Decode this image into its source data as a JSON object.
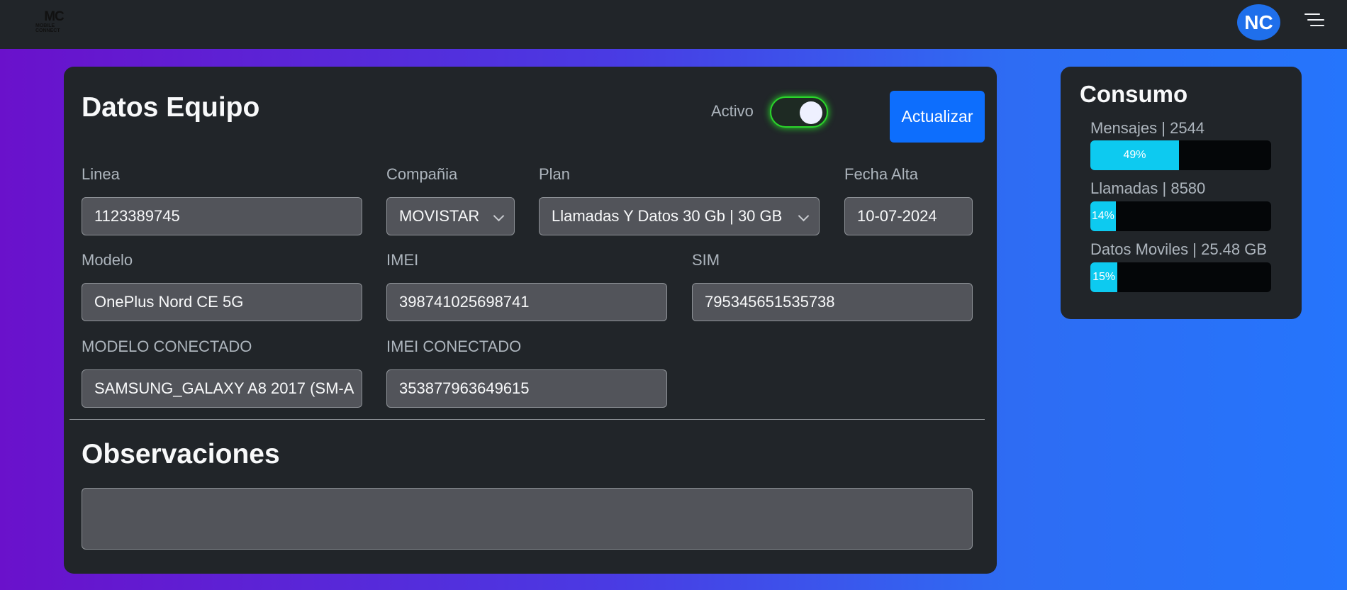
{
  "navbar": {
    "logo_text": "MC",
    "logo_subtext": "MOBILE CONNECT",
    "avatar_initials": "NC",
    "menu_icon": "hamburger-icon"
  },
  "equipo": {
    "title": "Datos Equipo",
    "activo_label": "Activo",
    "activo_state": true,
    "update_button": "Actualizar",
    "fields": {
      "linea": {
        "label": "Linea",
        "value": "1123389745"
      },
      "compania": {
        "label": "Compañia",
        "value": "MOVISTAR"
      },
      "plan": {
        "label": "Plan",
        "value": "Llamadas Y Datos 30 Gb | 30 GB"
      },
      "fecha_alta": {
        "label": "Fecha Alta",
        "value": "10-07-2024"
      },
      "modelo": {
        "label": "Modelo",
        "value": "OnePlus Nord CE 5G"
      },
      "imei": {
        "label": "IMEI",
        "value": "398741025698741"
      },
      "sim": {
        "label": "SIM",
        "value": "795345651535738"
      },
      "modelo_conectado": {
        "label": "MODELO CONECTADO",
        "value": "SAMSUNG_GALAXY A8 2017 (SM-A"
      },
      "imei_conectado": {
        "label": "IMEI CONECTADO",
        "value": "353877963649615"
      }
    },
    "observaciones_title": "Observaciones",
    "observaciones_value": ""
  },
  "consumo": {
    "title": "Consumo",
    "metrics": [
      {
        "label": "Mensajes | 2544",
        "percent_text": "49%",
        "percent": 49
      },
      {
        "label": "Llamadas | 8580",
        "percent_text": "14%",
        "percent": 14
      },
      {
        "label": "Datos Moviles | 25.48 GB",
        "percent_text": "15%",
        "percent": 15
      }
    ]
  },
  "colors": {
    "toggle_active": "#2bd52b",
    "primary_button": "#0d6efd",
    "progress_fill": "#0dcaf0",
    "avatar_bg": "#1f6feb"
  }
}
